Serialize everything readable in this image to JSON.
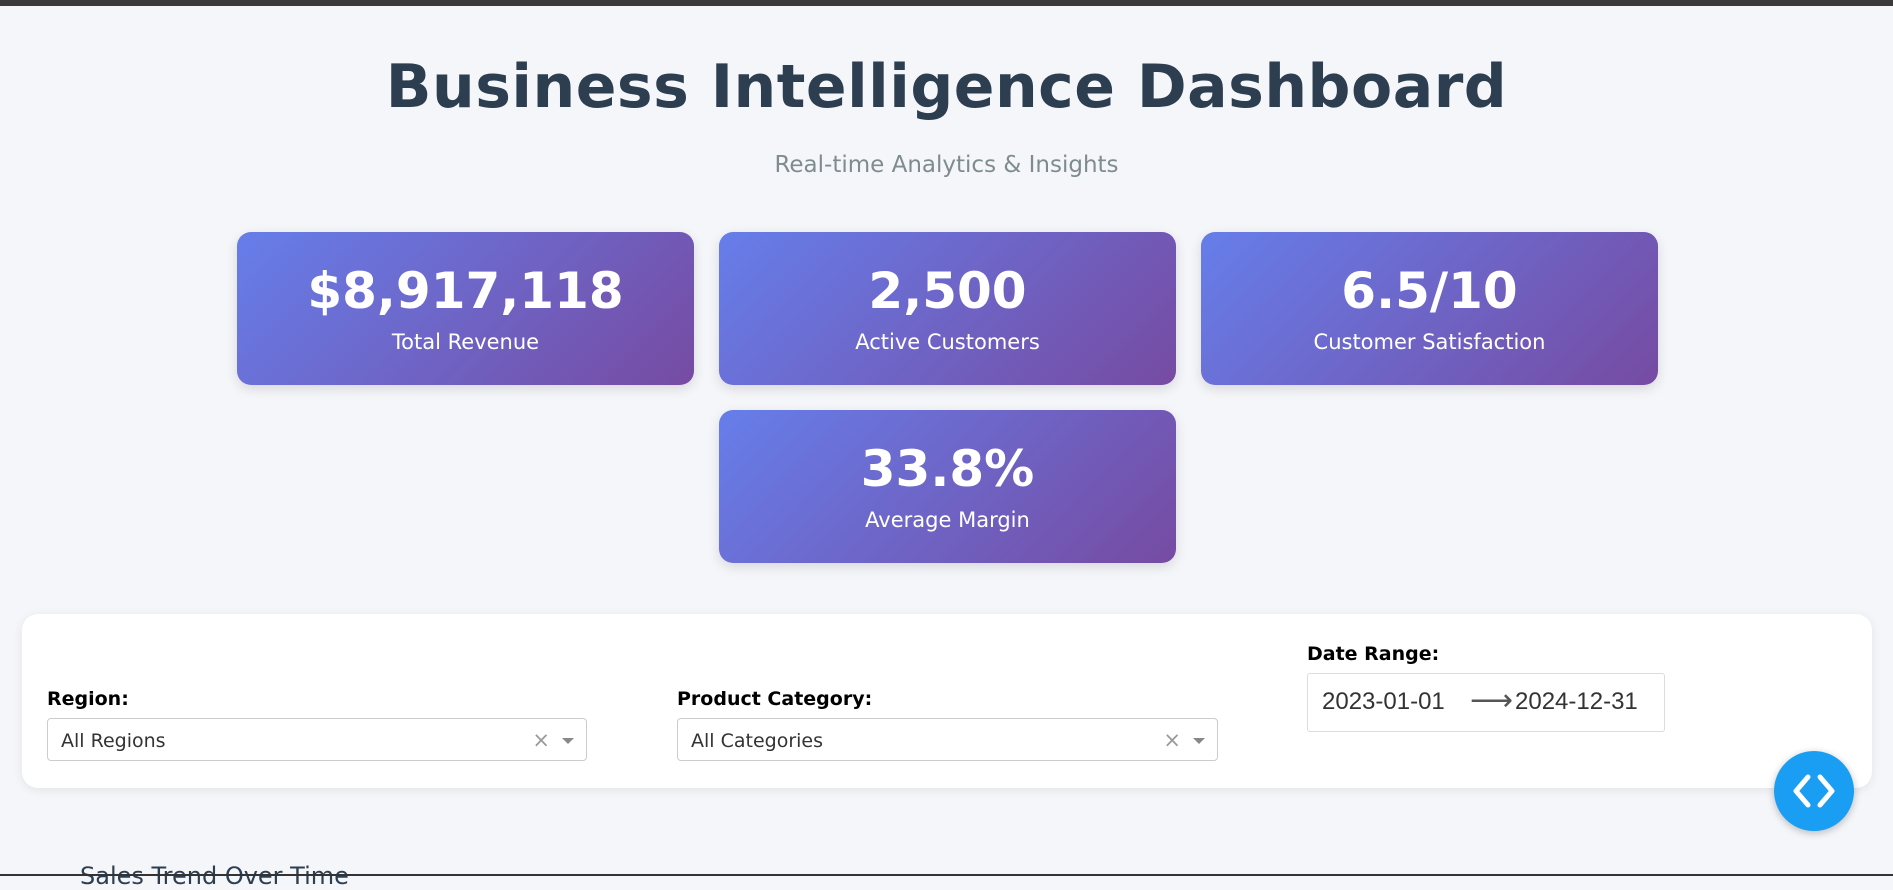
{
  "header": {
    "title": "Business Intelligence Dashboard",
    "subtitle": "Real-time Analytics & Insights"
  },
  "kpis": [
    {
      "value": "$8,917,118",
      "label": "Total Revenue"
    },
    {
      "value": "2,500",
      "label": "Active Customers"
    },
    {
      "value": "6.5/10",
      "label": "Customer Satisfaction"
    },
    {
      "value": "33.8%",
      "label": "Average Margin"
    }
  ],
  "filters": {
    "region": {
      "label": "Region:",
      "value": "All Regions"
    },
    "category": {
      "label": "Product Category:",
      "value": "All Categories"
    },
    "date_range": {
      "label": "Date Range:",
      "start": "2023-01-01",
      "end": "2024-12-31",
      "arrow": "⟶"
    },
    "clear_glyph": "×"
  },
  "next_section": {
    "heading": "Sales Trend Over Time"
  },
  "colors": {
    "kpi_gradient_start": "#667eea",
    "kpi_gradient_end": "#764ba2",
    "fab": "#199ef3",
    "title": "#2c3e50"
  },
  "icons": {
    "fab": "code-icon"
  }
}
